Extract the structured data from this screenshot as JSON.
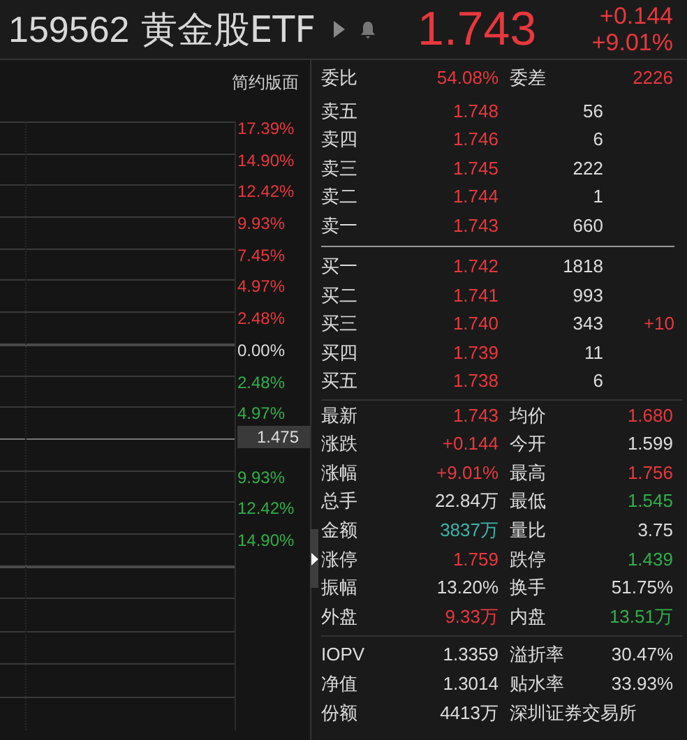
{
  "header": {
    "code": "159562",
    "name": "黄金股ETF",
    "price": "1.743",
    "change": "+0.144",
    "change_pct": "+9.01%"
  },
  "chart": {
    "mode_label": "简约版面",
    "price_tag": "1.475",
    "axis_labels": [
      {
        "text": "17.39%",
        "color": "#e8383d"
      },
      {
        "text": "14.90%",
        "color": "#e8383d"
      },
      {
        "text": "12.42%",
        "color": "#e8383d"
      },
      {
        "text": "9.93%",
        "color": "#e8383d"
      },
      {
        "text": "7.45%",
        "color": "#e8383d"
      },
      {
        "text": "4.97%",
        "color": "#e8383d"
      },
      {
        "text": "2.48%",
        "color": "#e8383d"
      },
      {
        "text": "0.00%",
        "color": "#dddddd"
      },
      {
        "text": "2.48%",
        "color": "#2fb04a"
      },
      {
        "text": "4.97%",
        "color": "#2fb04a"
      },
      {
        "text": "9.93%",
        "color": "#2fb04a"
      },
      {
        "text": "12.42%",
        "color": "#2fb04a"
      },
      {
        "text": "14.90%",
        "color": "#2fb04a"
      }
    ]
  },
  "order_ratio": [
    {
      "label": "委比",
      "value": "54.08%",
      "color": "#e8383d"
    },
    {
      "label": "委差",
      "value": "2226",
      "color": "#e8383d"
    }
  ],
  "asks": [
    {
      "label": "卖五",
      "price": "1.748",
      "volume": "56"
    },
    {
      "label": "卖四",
      "price": "1.746",
      "volume": "6"
    },
    {
      "label": "卖三",
      "price": "1.745",
      "volume": "222"
    },
    {
      "label": "卖二",
      "price": "1.744",
      "volume": "1"
    },
    {
      "label": "卖一",
      "price": "1.743",
      "volume": "660"
    }
  ],
  "bids": [
    {
      "label": "买一",
      "price": "1.742",
      "volume": "1818"
    },
    {
      "label": "买二",
      "price": "1.741",
      "volume": "993"
    },
    {
      "label": "买三",
      "price": "1.740",
      "volume": "343",
      "delta": "+10"
    },
    {
      "label": "买四",
      "price": "1.739",
      "volume": "11"
    },
    {
      "label": "买五",
      "price": "1.738",
      "volume": "6"
    }
  ],
  "quote_stats": [
    {
      "label": "最新",
      "value": "1.743",
      "color": "#e8383d"
    },
    {
      "label": "均价",
      "value": "1.680",
      "color": "#e8383d"
    },
    {
      "label": "涨跌",
      "value": "+0.144",
      "color": "#e8383d"
    },
    {
      "label": "今开",
      "value": "1.599",
      "color": "#dddddd"
    },
    {
      "label": "涨幅",
      "value": "+9.01%",
      "color": "#e8383d"
    },
    {
      "label": "最高",
      "value": "1.756",
      "color": "#e8383d"
    },
    {
      "label": "总手",
      "value": "22.84万",
      "color": "#dddddd"
    },
    {
      "label": "最低",
      "value": "1.545",
      "color": "#2fb04a"
    },
    {
      "label": "金额",
      "value": "3837万",
      "color": "#3cb4a8"
    },
    {
      "label": "量比",
      "value": "3.75",
      "color": "#dddddd"
    },
    {
      "label": "涨停",
      "value": "1.759",
      "color": "#e8383d"
    },
    {
      "label": "跌停",
      "value": "1.439",
      "color": "#2fb04a"
    },
    {
      "label": "振幅",
      "value": "13.20%",
      "color": "#dddddd"
    },
    {
      "label": "换手",
      "value": "51.75%",
      "color": "#dddddd"
    },
    {
      "label": "外盘",
      "value": "9.33万",
      "color": "#e8383d"
    },
    {
      "label": "内盘",
      "value": "13.51万",
      "color": "#2fb04a"
    }
  ],
  "fund_stats": [
    {
      "label": "IOPV",
      "value": "1.3359"
    },
    {
      "label": "溢折率",
      "value": "30.47%"
    },
    {
      "label": "净值",
      "value": "1.3014"
    },
    {
      "label": "贴水率",
      "value": "33.93%"
    },
    {
      "label": "份额",
      "value": "4413万"
    }
  ],
  "exchange": "深圳证券交易所"
}
